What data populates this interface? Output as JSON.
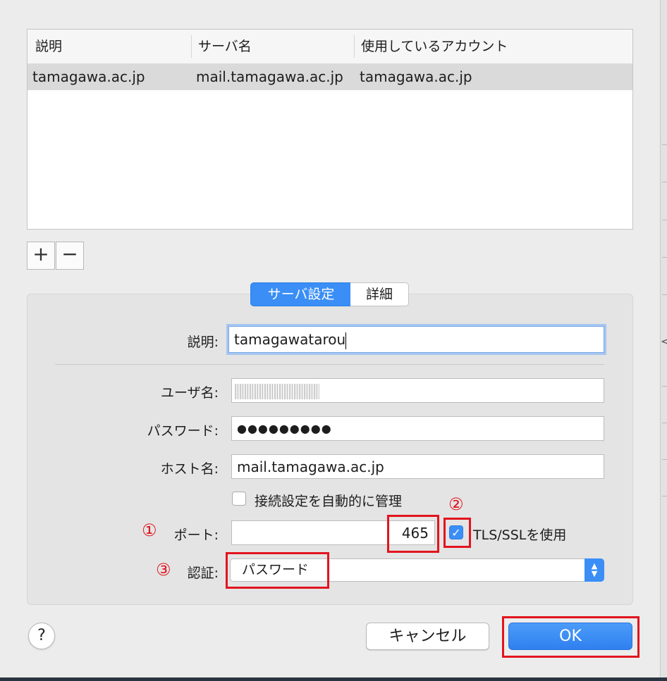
{
  "accounts_table": {
    "columns": [
      "説明",
      "サーバ名",
      "使用しているアカウント"
    ],
    "rows": [
      {
        "description": "tamagawa.ac.jp",
        "server": "mail.tamagawa.ac.jp",
        "account": "tamagawa.ac.jp"
      }
    ]
  },
  "list_buttons": {
    "add": "+",
    "remove": "−"
  },
  "tabs": {
    "server_settings": "サーバ設定",
    "details": "詳細"
  },
  "form": {
    "description_label": "説明:",
    "description_value": "tamagawatarou",
    "username_label": "ユーザ名:",
    "password_label": "パスワード:",
    "password_value": "●●●●●●●●●",
    "host_label": "ホスト名:",
    "host_value": "mail.tamagawa.ac.jp",
    "auto_manage_label": "接続設定を自動的に管理",
    "auto_manage_checked": false,
    "port_label": "ポート:",
    "port_value": "465",
    "tls_label": "TLS/SSLを使用",
    "tls_checked": true,
    "auth_label": "認証:",
    "auth_value": "パスワード"
  },
  "annotations": {
    "marker1": "①",
    "marker2": "②",
    "marker3": "③",
    "color": "#e2141e"
  },
  "footer": {
    "help": "?",
    "cancel": "キャンセル",
    "ok": "OK"
  },
  "colors": {
    "accent": "#3a8ef6"
  }
}
